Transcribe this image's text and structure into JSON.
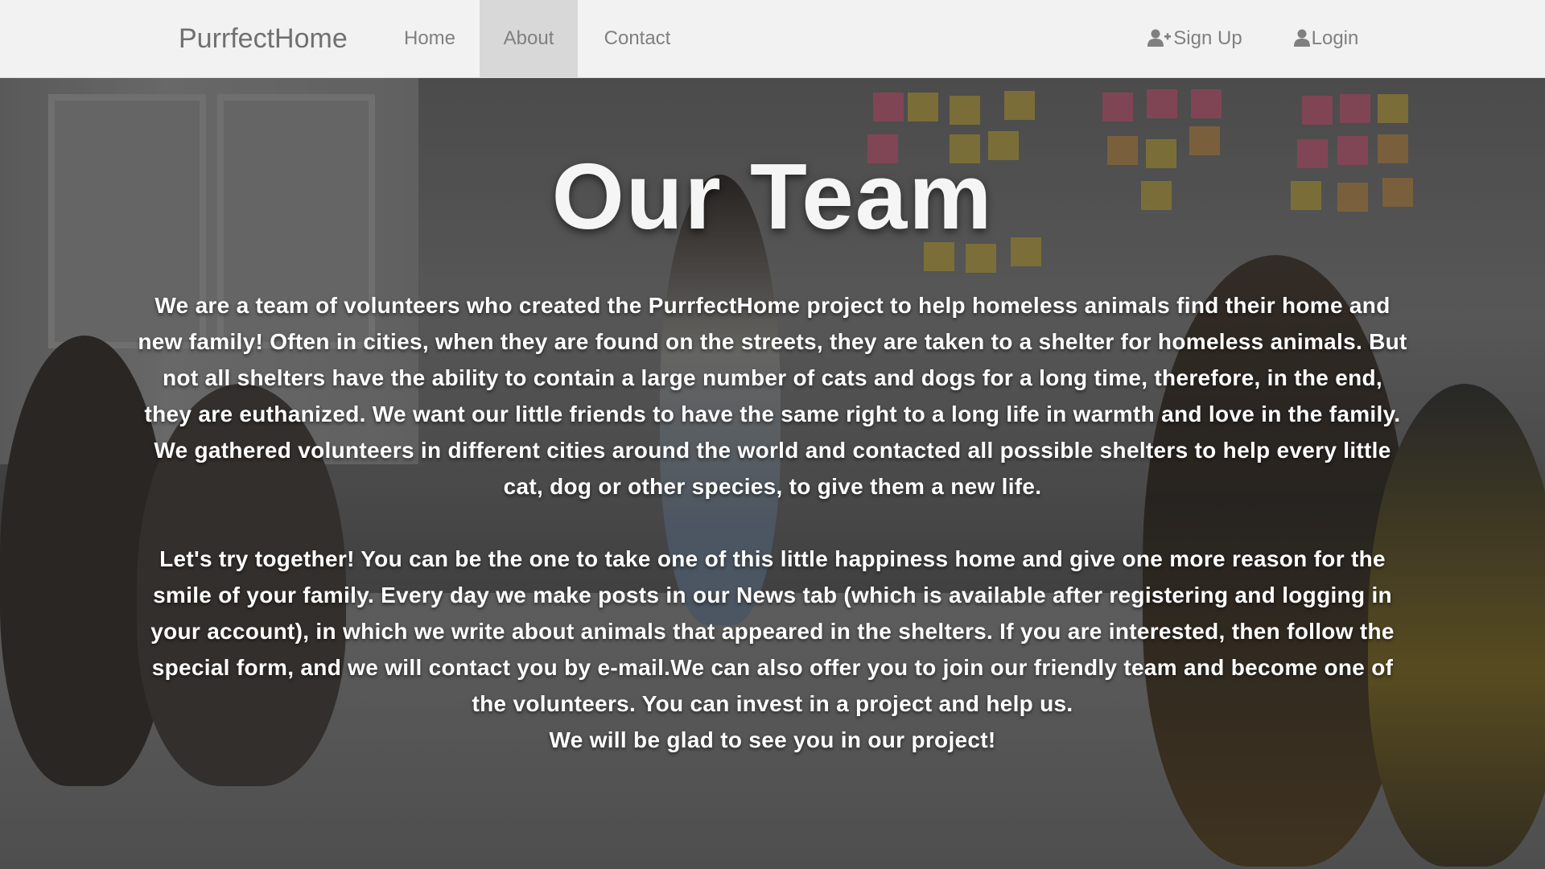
{
  "navbar": {
    "brand": "PurrfectHome",
    "links": [
      {
        "label": "Home",
        "active": false
      },
      {
        "label": "About",
        "active": true
      },
      {
        "label": "Contact",
        "active": false
      }
    ],
    "signup_label": "Sign Up",
    "signup_icon": "user-plus-icon",
    "login_label": "Login",
    "login_icon": "user-icon"
  },
  "hero": {
    "title": "Our Team",
    "paragraph1": "We are a team of volunteers who created the PurrfectHome project to help homeless animals find their home and new family! Often in cities, when they are found on the streets, they are taken to a shelter for homeless animals. But not all shelters have the ability to contain a large number of cats and dogs for a long time, therefore, in the end, they are euthanized. We want our little friends to have the same right to a long life in warmth and love in the family. We gathered volunteers in different cities around the world and contacted all possible shelters to help every little cat, dog or other species, to give them a new life.",
    "paragraph2": "Let's try together! You can be the one to take one of this little happiness home and give one more reason for the smile of your family. Every day we make posts in our News tab (which is available after registering and logging in your account), in which we write about animals that appeared in the shelters. If you are interested, then follow the special form, and we will contact you by e-mail.We can also offer you to join our friendly team and become one of the volunteers. You can invest in a project and help us.",
    "closing": "We will be glad to see you in our project!"
  },
  "colors": {
    "navbar_bg": "#f2f2f2",
    "active_tab_bg": "#d8d8d8",
    "nav_text": "#808080",
    "hero_text": "#ffffff"
  }
}
